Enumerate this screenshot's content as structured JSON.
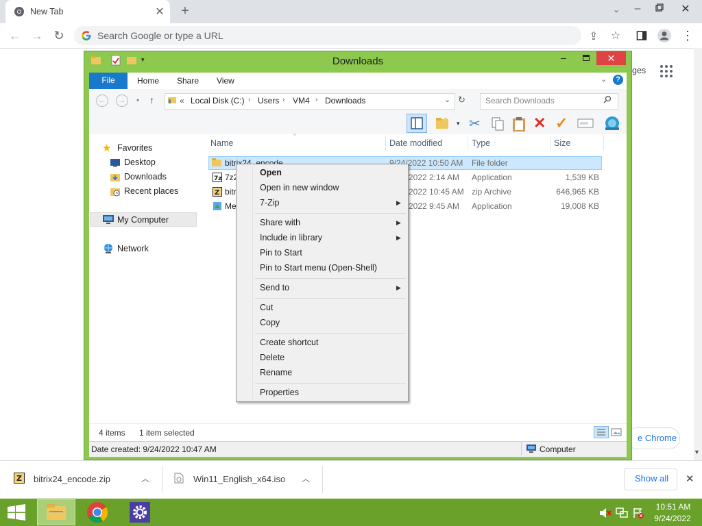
{
  "browser": {
    "tab_title": "New Tab",
    "omnibox_placeholder": "Search Google or type a URL",
    "page_peek_text": "ges",
    "page_peek_button": "e Chrome"
  },
  "explorer": {
    "title": "Downloads",
    "ribbon_tabs": [
      "File",
      "Home",
      "Share",
      "View"
    ],
    "breadcrumb": [
      "Local Disk (C:)",
      "Users",
      "VM4",
      "Downloads"
    ],
    "breadcrumb_prefix": "«",
    "search_placeholder": "Search Downloads",
    "nav": {
      "favorites": "Favorites",
      "desktop": "Desktop",
      "downloads": "Downloads",
      "recent": "Recent places",
      "computer": "My Computer",
      "network": "Network"
    },
    "columns": [
      "Name",
      "Date modified",
      "Type",
      "Size"
    ],
    "files": [
      {
        "name": "bitrix24_encode",
        "date": "9/24/2022 10:50 AM",
        "type": "File folder",
        "size": ""
      },
      {
        "name": "7z2",
        "date": "2022 2:14 AM",
        "type": "Application",
        "size": "1,539 KB"
      },
      {
        "name": "bitr",
        "date": "2022 10:45 AM",
        "type": "zip Archive",
        "size": "646,965 KB"
      },
      {
        "name": "Me",
        "date": "2022 9:45 AM",
        "type": "Application",
        "size": "19,008 KB"
      }
    ],
    "status_items": "4 items",
    "status_selected": "1 item selected",
    "details_left": "Date created: 9/24/2022 10:47 AM",
    "details_right": "Computer"
  },
  "context_menu": {
    "open": "Open",
    "open_new_window": "Open in new window",
    "seven_zip": "7-Zip",
    "share_with": "Share with",
    "include_in_library": "Include in library",
    "pin_to_start": "Pin to Start",
    "pin_open_shell": "Pin to Start menu (Open-Shell)",
    "send_to": "Send to",
    "cut": "Cut",
    "copy": "Copy",
    "create_shortcut": "Create shortcut",
    "delete": "Delete",
    "rename": "Rename",
    "properties": "Properties"
  },
  "downloads_shelf": {
    "item1": "bitrix24_encode.zip",
    "item2": "Win11_English_x64.iso",
    "show_all": "Show all"
  },
  "taskbar": {
    "time": "10:51 AM",
    "date": "9/24/2022"
  },
  "colors": {
    "window_frame": "#8dc84f",
    "taskbar": "#6aa12a",
    "file_tab": "#1979ca",
    "close_button": "#e04343",
    "selection": "#cce8ff"
  }
}
